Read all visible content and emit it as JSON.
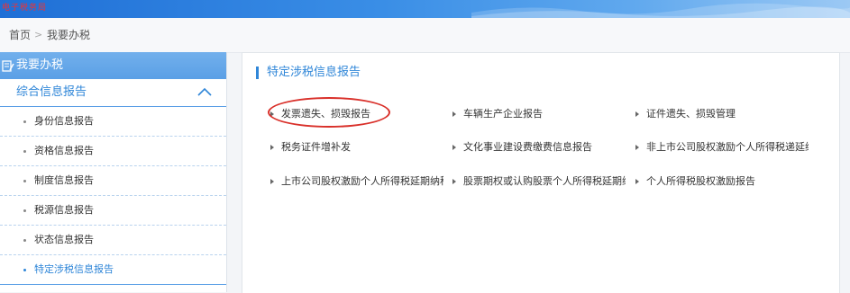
{
  "header": {
    "logo_text": "电子税务局"
  },
  "breadcrumb": {
    "home": "首页",
    "separator": ">",
    "current": "我要办税"
  },
  "sidebar": {
    "title": "我要办税",
    "group": "综合信息报告",
    "items": [
      {
        "label": "身份信息报告"
      },
      {
        "label": "资格信息报告"
      },
      {
        "label": "制度信息报告"
      },
      {
        "label": "税源信息报告"
      },
      {
        "label": "状态信息报告"
      },
      {
        "label": "特定涉税信息报告"
      }
    ]
  },
  "panel": {
    "title": "特定涉税信息报告",
    "items": [
      {
        "label": "发票遗失、损毁报告"
      },
      {
        "label": "车辆生产企业报告"
      },
      {
        "label": "证件遗失、损毁管理"
      },
      {
        "label": "税务证件增补发"
      },
      {
        "label": "文化事业建设费缴费信息报告"
      },
      {
        "label": "非上市公司股权激励个人所得税递延纳"
      },
      {
        "label": "上市公司股权激励个人所得税延期纳税"
      },
      {
        "label": "股票期权或认购股票个人所得税延期纳"
      },
      {
        "label": "个人所得税股权激励报告"
      }
    ]
  },
  "colors": {
    "accent": "#2f86d8",
    "highlight": "#d9302a",
    "header_blue": "#3a8ee6"
  }
}
